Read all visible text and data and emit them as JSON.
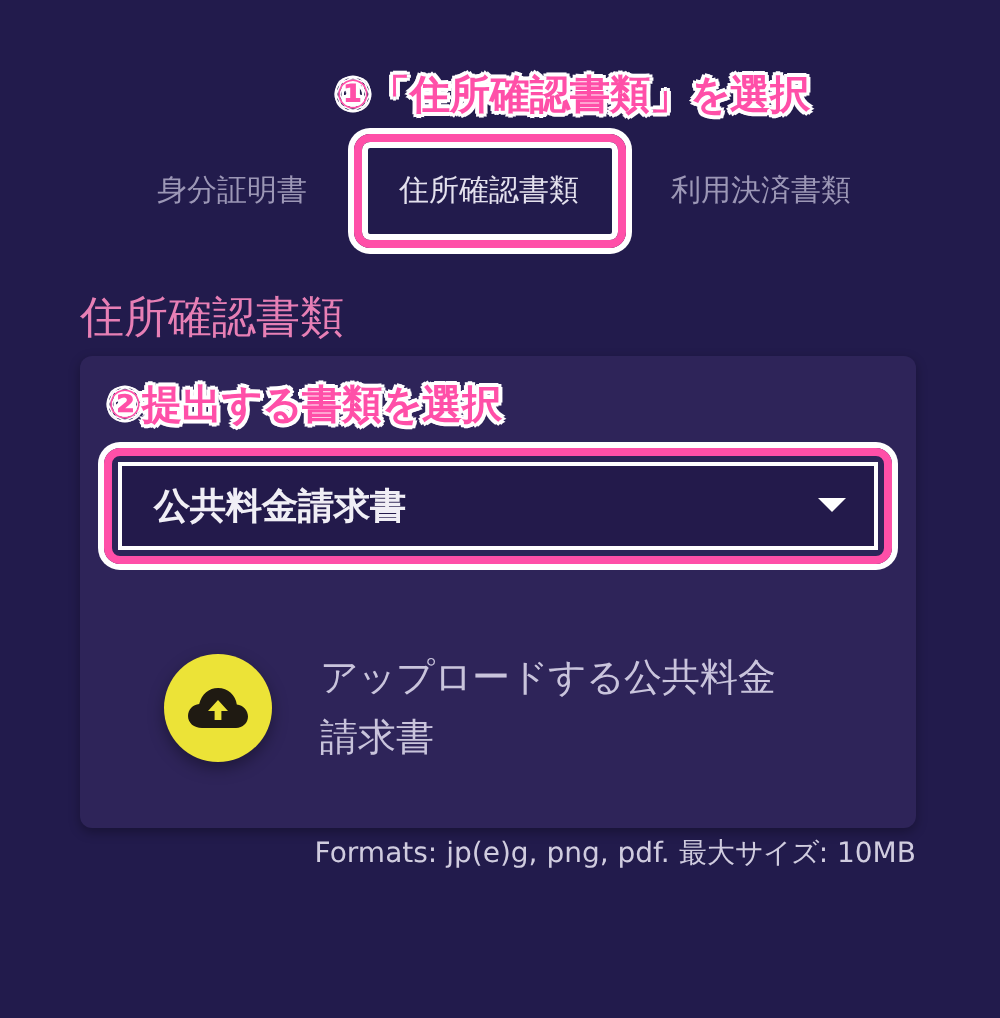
{
  "annotations": [
    {
      "text": "①「住所確認書類」を選択"
    },
    {
      "text": "②提出する書類を選択"
    }
  ],
  "tabs": [
    {
      "label": "身分証明書",
      "selected": false
    },
    {
      "label": "住所確認書類",
      "selected": true
    },
    {
      "label": "利用決済書類",
      "selected": false
    }
  ],
  "section_title": "住所確認書類",
  "document_select": {
    "value": "公共料金請求書"
  },
  "upload": {
    "label": "アップロードする公共料金請求書"
  },
  "formats_note": "Formats: jp(e)g, png, pdf. 最大サイズ: 10MB"
}
